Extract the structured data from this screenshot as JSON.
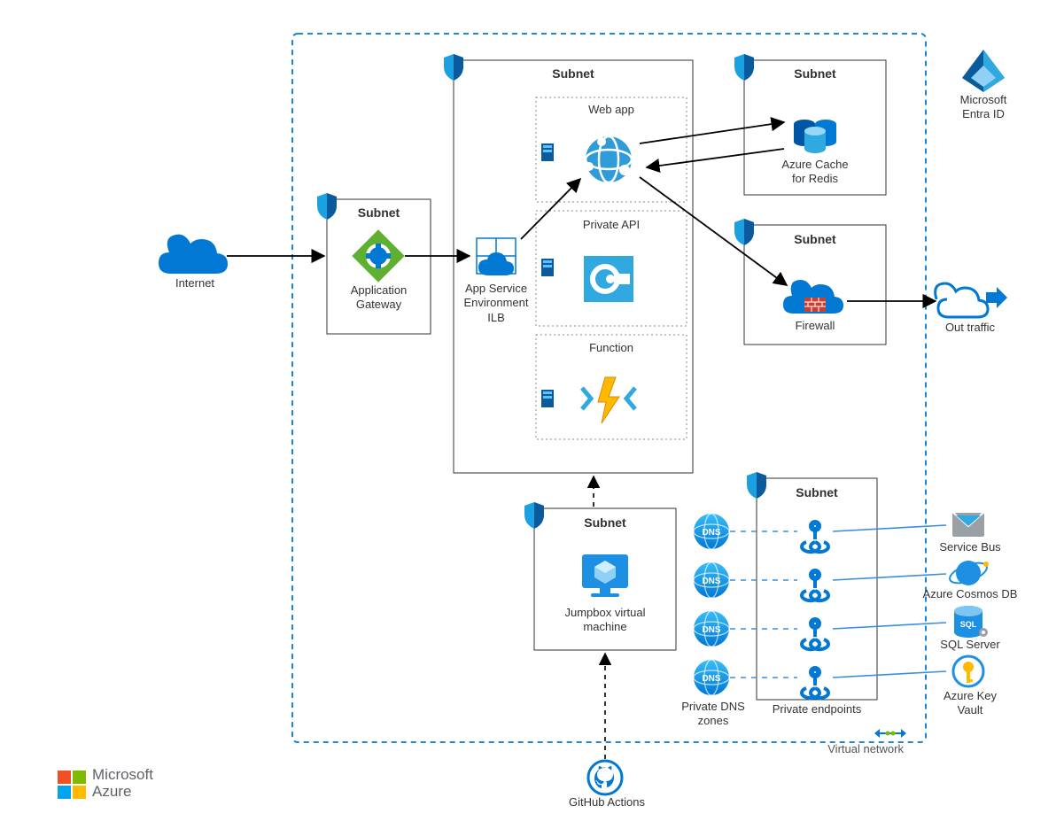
{
  "vnet": {
    "label": "Virtual network"
  },
  "entra": {
    "label": "Microsoft\nEntra ID"
  },
  "internet": {
    "label": "Internet"
  },
  "appGatewaySubnet": {
    "title": "Subnet"
  },
  "appGateway": {
    "label": "Application\nGateway"
  },
  "aseSubnet": {
    "title": "Subnet"
  },
  "aseIlb": {
    "label": "App Service\nEnvironment\nILB"
  },
  "webApp": {
    "label": "Web app"
  },
  "privateApi": {
    "label": "Private API"
  },
  "function": {
    "label": "Function"
  },
  "redisSubnet": {
    "title": "Subnet"
  },
  "redis": {
    "label": "Azure Cache\nfor Redis"
  },
  "firewallSubnet": {
    "title": "Subnet"
  },
  "firewall": {
    "label": "Firewall"
  },
  "outTraffic": {
    "label": "Out traffic"
  },
  "jumpboxSubnet": {
    "title": "Subnet"
  },
  "jumpbox": {
    "label": "Jumpbox virtual\nmachine"
  },
  "pe": {
    "title": "Subnet",
    "endpoints": "Private endpoints"
  },
  "dnsZones": {
    "label": "Private DNS\nzones"
  },
  "serviceBus": {
    "label": "Service Bus"
  },
  "cosmos": {
    "label": "Azure Cosmos DB"
  },
  "sql": {
    "label": "SQL Server"
  },
  "keyvault": {
    "label": "Azure Key\nVault"
  },
  "github": {
    "label": "GitHub Actions"
  },
  "azureLogo": {
    "line1": "Microsoft",
    "line2": "Azure"
  }
}
